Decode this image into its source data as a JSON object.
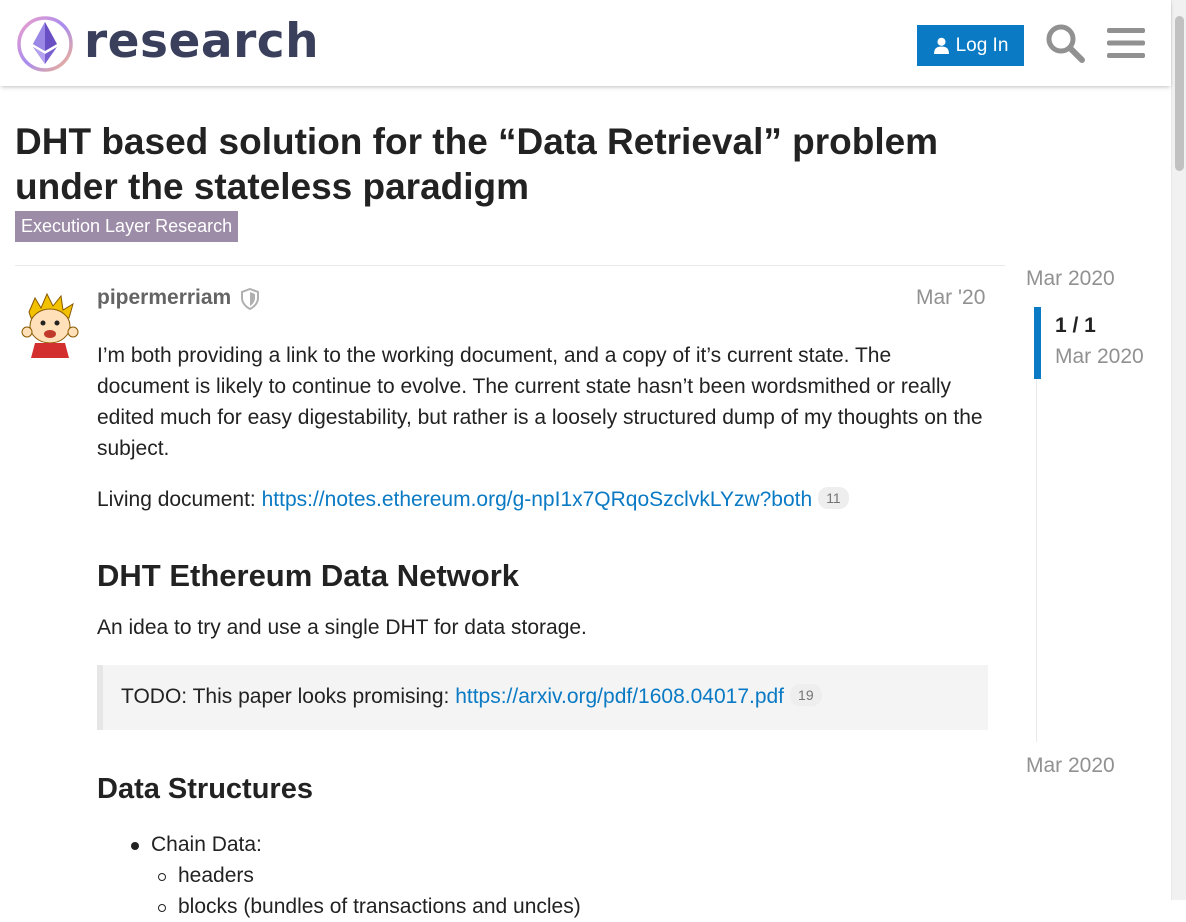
{
  "header": {
    "site_name": "research",
    "login_label": "Log In"
  },
  "topic": {
    "title": "DHT based solution for the “Data Retrieval” problem under the stateless paradigm",
    "category": "Execution Layer Research"
  },
  "post": {
    "username": "pipermerriam",
    "date": "Mar '20",
    "paragraph1": "I’m both providing a link to the working document, and a copy of it’s current state. The document is likely to continue to evolve. The current state hasn’t been wordsmithed or really edited much for easy digestability, but rather is a loosely structured dump of my thoughts on the subject.",
    "living_doc_label": "Living document: ",
    "living_doc_link": "https://notes.ethereum.org/g-npI1x7QRqoSzclvkLYzw?both",
    "living_doc_clicks": "11",
    "heading1": "DHT Ethereum Data Network",
    "paragraph3": "An idea to try and use a single DHT for data storage.",
    "quote_label": "TODO: This paper looks promising: ",
    "quote_link": "https://arxiv.org/pdf/1608.04017.pdf",
    "quote_clicks": "19",
    "heading2": "Data Structures",
    "list_item1": "Chain Data:",
    "sub_item1": "headers",
    "sub_item2": "blocks (bundles of transactions and uncles)"
  },
  "timeline": {
    "start": "Mar 2020",
    "counter": "1 / 1",
    "current_date": "Mar 2020",
    "end": "Mar 2020"
  },
  "colors": {
    "accent": "#0a7ac4",
    "category": "#9d8ca8"
  }
}
